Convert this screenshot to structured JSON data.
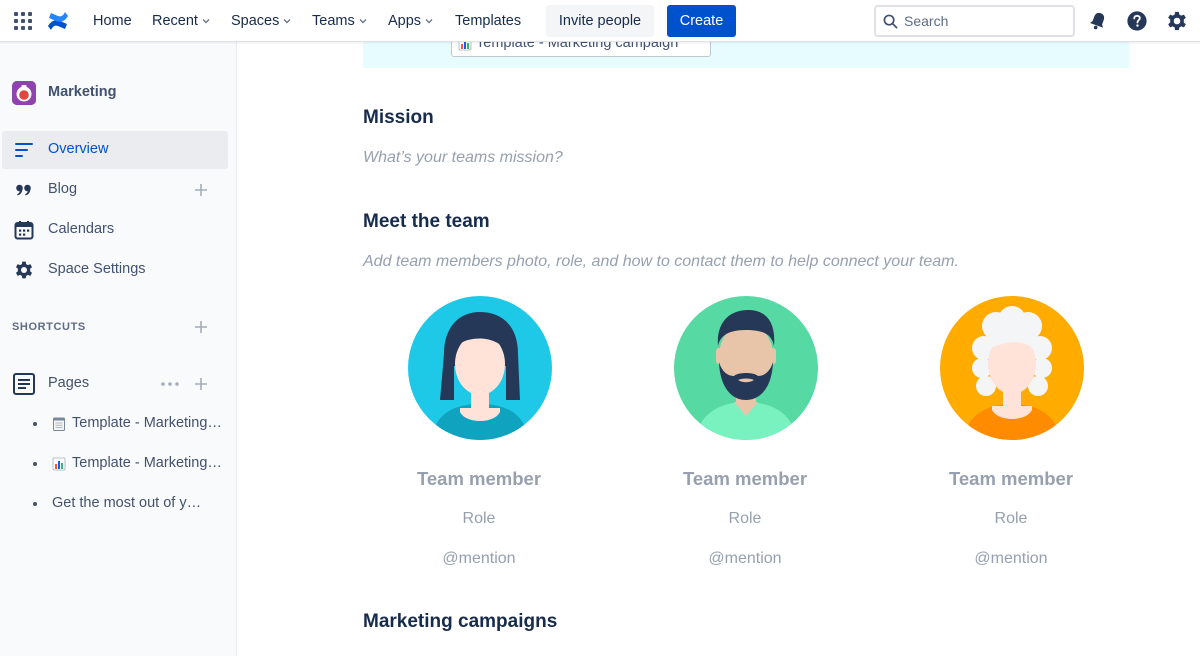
{
  "topnav": {
    "items": [
      {
        "label": "Home",
        "dropdown": false
      },
      {
        "label": "Recent",
        "dropdown": true
      },
      {
        "label": "Spaces",
        "dropdown": true
      },
      {
        "label": "Teams",
        "dropdown": true
      },
      {
        "label": "Apps",
        "dropdown": true
      },
      {
        "label": "Templates",
        "dropdown": false
      }
    ],
    "invite_label": "Invite people",
    "create_label": "Create",
    "search_placeholder": "Search"
  },
  "sidebar": {
    "space_name": "Marketing",
    "items": [
      {
        "label": "Overview",
        "active": true
      },
      {
        "label": "Blog",
        "active": false
      },
      {
        "label": "Calendars",
        "active": false
      },
      {
        "label": "Space Settings",
        "active": false
      }
    ],
    "shortcuts_label": "SHORTCUTS",
    "pages_label": "Pages",
    "pages": [
      {
        "label": "Template - Marketing plan",
        "icon": "notepad-icon"
      },
      {
        "label": "Template - Marketing campaign",
        "icon": "bar-chart-icon"
      },
      {
        "label": "Get the most out of your team space",
        "icon": ""
      }
    ]
  },
  "content": {
    "banner_link": "Template - Marketing campaign",
    "mission_heading": "Mission",
    "mission_placeholder": "What’s your teams mission?",
    "team_heading": "Meet the team",
    "team_placeholder": "Add team members photo, role, and how to contact them to help connect your team.",
    "members": [
      {
        "name": "Team member",
        "role": "Role",
        "mention": "@mention",
        "bg": "#1ec8e7"
      },
      {
        "name": "Team member",
        "role": "Role",
        "mention": "@mention",
        "bg": "#57d9a3"
      },
      {
        "name": "Team member",
        "role": "Role",
        "mention": "@mention",
        "bg": "#ffab00"
      }
    ],
    "campaigns_heading": "Marketing campaigns"
  },
  "colors": {
    "primary": "#0052cc",
    "sidebar_bg": "#f9fafc",
    "placeholder_text": "#97a0af",
    "banner_bg": "#e6fcff"
  }
}
